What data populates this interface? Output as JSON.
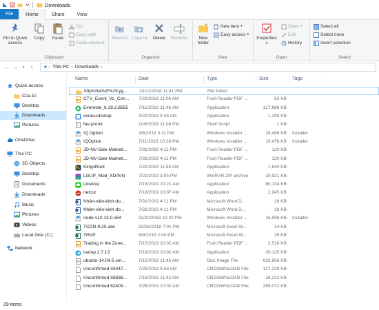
{
  "window": {
    "title": "Downloads"
  },
  "tabs": [
    "File",
    "Home",
    "Share",
    "View"
  ],
  "ribbon": {
    "clipboard": {
      "label": "Clipboard",
      "pin": "Pin to Quick access",
      "copy": "Copy",
      "paste": "Paste",
      "cut": "Cut",
      "copy_path": "Copy path",
      "paste_shortcut": "Paste shortcut"
    },
    "organize": {
      "label": "Organize",
      "move_to": "Move to",
      "copy_to": "Copy to",
      "delete": "Delete",
      "rename": "Rename"
    },
    "new": {
      "label": "New",
      "new_folder": "New folder",
      "new_item": "New item",
      "easy_access": "Easy access"
    },
    "open": {
      "label": "Open",
      "properties": "Properties",
      "open": "Open",
      "edit": "Edit",
      "history": "History"
    },
    "select": {
      "label": "Select",
      "select_all": "Select all",
      "select_none": "Select none",
      "invert": "Invert selection"
    }
  },
  "address": {
    "crumbs": [
      "This PC",
      "Downloads"
    ]
  },
  "nav": {
    "items": [
      {
        "label": "Quick access",
        "icon": "star-icon",
        "indent": 0
      },
      {
        "label": "Của Di",
        "icon": "folder-icon",
        "indent": 1
      },
      {
        "label": "Desktop",
        "icon": "desktop-icon",
        "indent": 1
      },
      {
        "label": "Downloads",
        "icon": "download-icon",
        "indent": 1,
        "selected": true
      },
      {
        "label": "Pictures",
        "icon": "pictures-icon",
        "indent": 1
      },
      {
        "label": "OneDrive",
        "icon": "cloud-icon",
        "indent": 0
      },
      {
        "label": "This PC",
        "icon": "computer-icon",
        "indent": 0
      },
      {
        "label": "3D Objects",
        "icon": "cube-icon",
        "indent": 1
      },
      {
        "label": "Desktop",
        "icon": "desktop-icon",
        "indent": 1
      },
      {
        "label": "Documents",
        "icon": "documents-icon",
        "indent": 1
      },
      {
        "label": "Downloads",
        "icon": "download-icon",
        "indent": 1
      },
      {
        "label": "Music",
        "icon": "music-icon",
        "indent": 1
      },
      {
        "label": "Pictures",
        "icon": "pictures-icon",
        "indent": 1
      },
      {
        "label": "Videos",
        "icon": "videos-icon",
        "indent": 1
      },
      {
        "label": "Local Disk (C:)",
        "icon": "disk-icon",
        "indent": 1
      },
      {
        "label": "Network",
        "icon": "network-icon",
        "indent": 0
      }
    ]
  },
  "columns": [
    "Name",
    "Date",
    "Type",
    "Size",
    "Tags"
  ],
  "files": [
    {
      "name": "http%3a%2f%2fcyg...",
      "date": "10/11/2018 11:41 PM",
      "type": "File folder",
      "size": "",
      "tags": "",
      "icon": "folder-icon"
    },
    {
      "name": "CTV_Event_Vo_Con...",
      "date": "7/22/2019 11:06 AM",
      "type": "Foxit Reader PDF ...",
      "size": "62 KB",
      "tags": "",
      "icon": "pdf-icon"
    },
    {
      "name": "Evernote_6.19.2.8555",
      "date": "7/15/2019 11:46 AM",
      "type": "Application",
      "size": "127,686 KB",
      "tags": "",
      "icon": "evernote-icon"
    },
    {
      "name": "exness4setup",
      "date": "3/22/2019 9:48 AM",
      "type": "Application",
      "size": "1,295 KB",
      "tags": "",
      "icon": "app-icon"
    },
    {
      "name": "fav-promt",
      "date": "10/8/2018 11:06 PM",
      "type": "Shell Script",
      "size": "1 KB",
      "tags": "",
      "icon": "script-icon"
    },
    {
      "name": "IQ Option",
      "date": "3/6/2019 3:11 PM",
      "type": "Windows Installer ...",
      "size": "28,488 KB",
      "tags": "Installer",
      "icon": "installer-icon"
    },
    {
      "name": "IQOption",
      "date": "7/11/2019 10:28 PM",
      "type": "Windows Installer ...",
      "size": "19,476 KB",
      "tags": "Installer",
      "icon": "installer-icon"
    },
    {
      "name": "JD-NV-Sale-Marketi...",
      "date": "7/31/2019 4:11 PM",
      "type": "Foxit Reader PDF ...",
      "size": "120 KB",
      "tags": "",
      "icon": "pdf-icon"
    },
    {
      "name": "JD-NV-Sale-Marketi...",
      "date": "7/31/2019 4:11 PM",
      "type": "Foxit Reader PDF ...",
      "size": "120 KB",
      "tags": "",
      "icon": "pdf-icon"
    },
    {
      "name": "KingoRoot",
      "date": "7/22/2019 11:53 AM",
      "type": "Application",
      "size": "1,840 KB",
      "tags": "",
      "icon": "kingo-icon"
    },
    {
      "name": "LGUP_Mod_XDAVN",
      "date": "7/22/2019 3:05 PM",
      "type": "WinRAR ZIP archive",
      "size": "15,921 KB",
      "tags": "",
      "icon": "archive-icon"
    },
    {
      "name": "LineInst",
      "date": "7/15/2019 10:21 AM",
      "type": "Application",
      "size": "80,134 KB",
      "tags": "",
      "icon": "line-icon"
    },
    {
      "name": "netcut",
      "date": "7/19/2019 10:07 AM",
      "type": "Application",
      "size": "2,945 KB",
      "tags": "",
      "icon": "netcut-icon"
    },
    {
      "name": "Nhân-viên-kinh-do...",
      "date": "7/31/2019 4:11 PM",
      "type": "Microsoft Word D...",
      "size": "18 KB",
      "tags": "",
      "icon": "word-icon"
    },
    {
      "name": "Nhân-viên-kinh-do...",
      "date": "7/31/2019 4:11 PM",
      "type": "Microsoft Word D...",
      "size": "18 KB",
      "tags": "",
      "icon": "word-icon"
    },
    {
      "name": "node-v10.13.0-x64",
      "date": "11/20/2018 10:20 PM",
      "type": "Windows Installer ...",
      "size": "16,896 KB",
      "tags": "Installer",
      "icon": "installer-icon"
    },
    {
      "name": "TCDN-9.20-abc",
      "date": "10/28/2018 7:01 PM",
      "type": "Microsoft Excel W...",
      "size": "14 KB",
      "tags": "",
      "icon": "excel-icon"
    },
    {
      "name": "THVP",
      "date": "6/9/2019 2:04 PM",
      "type": "Microsoft Excel W...",
      "size": "35 KB",
      "tags": "",
      "icon": "excel-icon"
    },
    {
      "name": "Trading in the Zone...",
      "date": "7/15/2019 10:02 AM",
      "type": "Foxit Reader PDF ...",
      "size": "2,516 KB",
      "tags": "",
      "icon": "pdf-icon"
    },
    {
      "name": "tsetup.1.7.13",
      "date": "7/19/2019 10:02 AM",
      "type": "Application",
      "size": "20,125 KB",
      "tags": "",
      "icon": "telegram-icon"
    },
    {
      "name": "ubuntu-14.04.5-ser...",
      "date": "7/15/2019 11:43 AM",
      "type": "Disc Image File",
      "size": "633,856 KB",
      "tags": "",
      "icon": "disc-icon"
    },
    {
      "name": "Unconfirmed 45047...",
      "date": "7/25/2019 9:58 AM",
      "type": "CRDOWNLOAD File",
      "size": "127,229 KB",
      "tags": "",
      "icon": "file-icon"
    },
    {
      "name": "Unconfirmed 59836...",
      "date": "7/16/2019 11:42 AM",
      "type": "CRDOWNLOAD File",
      "size": "16,212 KB",
      "tags": "",
      "icon": "file-icon"
    },
    {
      "name": "Unconfirmed 62409...",
      "date": "7/25/2019 10:02 AM",
      "type": "CRDOWNLOAD File",
      "size": "259,072 KB",
      "tags": "",
      "icon": "file-icon"
    }
  ],
  "status": {
    "count": "29 items"
  },
  "colors": {
    "accent": "#1979ca",
    "selected": "#cce8ff",
    "folder": "#f7c85a",
    "pdf": "#e8a13a",
    "word": "#2b5797",
    "excel": "#1e7145"
  }
}
